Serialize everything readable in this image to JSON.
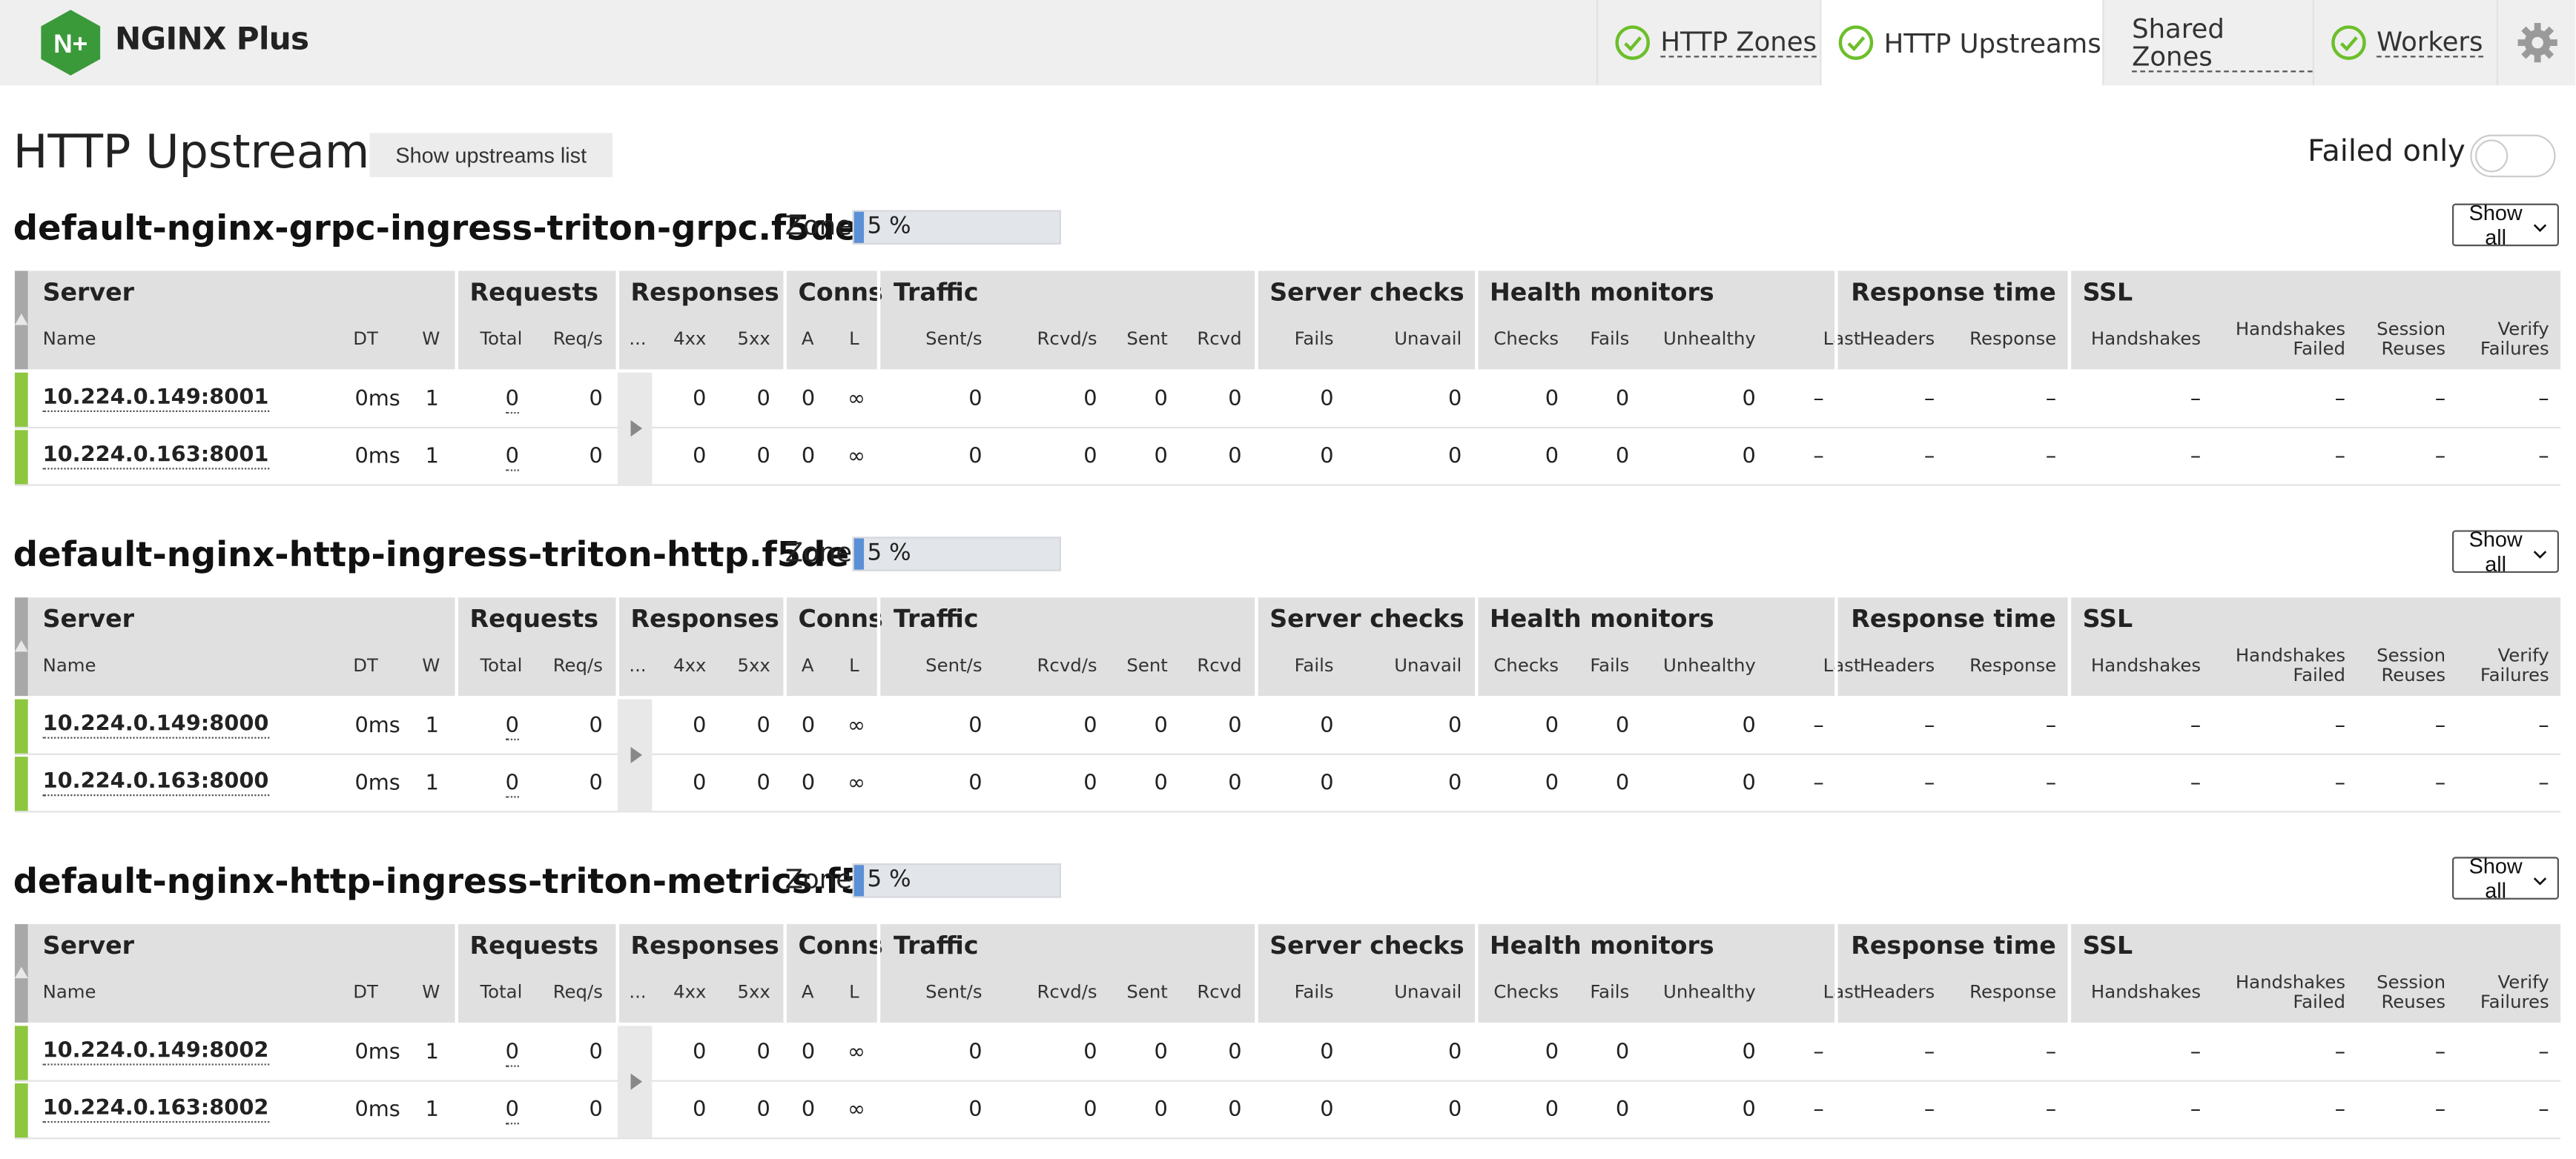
{
  "brand": {
    "name": "NGINX Plus",
    "logo_glyph": "N+",
    "color": "#3a9a3a"
  },
  "nav": {
    "tabs": [
      {
        "label": "HTTP Zones",
        "status": "ok",
        "active": false
      },
      {
        "label": "HTTP Upstreams",
        "status": "ok",
        "active": true
      },
      {
        "label": "Shared Zones",
        "status": "",
        "active": false
      },
      {
        "label": "Workers",
        "status": "ok",
        "active": false
      }
    ],
    "settings_icon": "gear-icon"
  },
  "page": {
    "title": "HTTP Upstreams",
    "list_button": "Show upstreams list",
    "failed_only_label": "Failed only",
    "failed_only_on": false
  },
  "columns": {
    "groups": [
      "Server",
      "Requests",
      "Responses",
      "Conns",
      "Traffic",
      "Server checks",
      "Health monitors",
      "Response time",
      "SSL"
    ],
    "sub": [
      "Name",
      "DT",
      "W",
      "Total",
      "Req/s",
      "...",
      "4xx",
      "5xx",
      "A",
      "L",
      "Sent/s",
      "Rcvd/s",
      "Sent",
      "Rcvd",
      "Fails",
      "Unavail",
      "Checks",
      "Fails",
      "Unhealthy",
      "Last",
      "Headers",
      "Response",
      "Handshakes",
      "Handshakes Failed",
      "Session Reuses",
      "Verify Failures"
    ]
  },
  "upstreams": [
    {
      "name": "default-nginx-grpc-ingress-triton-grpc.f5de...",
      "zone_label": "Zone:",
      "zone_percent": "5 %",
      "zone_fraction": 0.05,
      "show_all": "Show all",
      "servers": [
        {
          "name": "10.224.0.149:8001",
          "dt": "0ms",
          "w": "1",
          "total": "0",
          "req_s": "0",
          "r4xx": "0",
          "r5xx": "0",
          "a": "0",
          "l": "∞",
          "sent_s": "0",
          "rcvd_s": "0",
          "sent": "0",
          "rcvd": "0",
          "fails": "0",
          "unavail": "0",
          "checks": "0",
          "hm_fails": "0",
          "unhealthy": "0",
          "last": "–",
          "headers": "–",
          "response": "–",
          "handshakes": "–",
          "hs_failed": "–",
          "session_reuses": "–",
          "verify_failures": "–"
        },
        {
          "name": "10.224.0.163:8001",
          "dt": "0ms",
          "w": "1",
          "total": "0",
          "req_s": "0",
          "r4xx": "0",
          "r5xx": "0",
          "a": "0",
          "l": "∞",
          "sent_s": "0",
          "rcvd_s": "0",
          "sent": "0",
          "rcvd": "0",
          "fails": "0",
          "unavail": "0",
          "checks": "0",
          "hm_fails": "0",
          "unhealthy": "0",
          "last": "–",
          "headers": "–",
          "response": "–",
          "handshakes": "–",
          "hs_failed": "–",
          "session_reuses": "–",
          "verify_failures": "–"
        }
      ]
    },
    {
      "name": "default-nginx-http-ingress-triton-http.f5de...",
      "zone_label": "Zone:",
      "zone_percent": "5 %",
      "zone_fraction": 0.05,
      "show_all": "Show all",
      "servers": [
        {
          "name": "10.224.0.149:8000",
          "dt": "0ms",
          "w": "1",
          "total": "0",
          "req_s": "0",
          "r4xx": "0",
          "r5xx": "0",
          "a": "0",
          "l": "∞",
          "sent_s": "0",
          "rcvd_s": "0",
          "sent": "0",
          "rcvd": "0",
          "fails": "0",
          "unavail": "0",
          "checks": "0",
          "hm_fails": "0",
          "unhealthy": "0",
          "last": "–",
          "headers": "–",
          "response": "–",
          "handshakes": "–",
          "hs_failed": "–",
          "session_reuses": "–",
          "verify_failures": "–"
        },
        {
          "name": "10.224.0.163:8000",
          "dt": "0ms",
          "w": "1",
          "total": "0",
          "req_s": "0",
          "r4xx": "0",
          "r5xx": "0",
          "a": "0",
          "l": "∞",
          "sent_s": "0",
          "rcvd_s": "0",
          "sent": "0",
          "rcvd": "0",
          "fails": "0",
          "unavail": "0",
          "checks": "0",
          "hm_fails": "0",
          "unhealthy": "0",
          "last": "–",
          "headers": "–",
          "response": "–",
          "handshakes": "–",
          "hs_failed": "–",
          "session_reuses": "–",
          "verify_failures": "–"
        }
      ]
    },
    {
      "name": "default-nginx-http-ingress-triton-metrics.f5...",
      "zone_label": "Zone:",
      "zone_percent": "5 %",
      "zone_fraction": 0.05,
      "show_all": "Show all",
      "servers": [
        {
          "name": "10.224.0.149:8002",
          "dt": "0ms",
          "w": "1",
          "total": "0",
          "req_s": "0",
          "r4xx": "0",
          "r5xx": "0",
          "a": "0",
          "l": "∞",
          "sent_s": "0",
          "rcvd_s": "0",
          "sent": "0",
          "rcvd": "0",
          "fails": "0",
          "unavail": "0",
          "checks": "0",
          "hm_fails": "0",
          "unhealthy": "0",
          "last": "–",
          "headers": "–",
          "response": "–",
          "handshakes": "–",
          "hs_failed": "–",
          "session_reuses": "–",
          "verify_failures": "–"
        },
        {
          "name": "10.224.0.163:8002",
          "dt": "0ms",
          "w": "1",
          "total": "0",
          "req_s": "0",
          "r4xx": "0",
          "r5xx": "0",
          "a": "0",
          "l": "∞",
          "sent_s": "0",
          "rcvd_s": "0",
          "sent": "0",
          "rcvd": "0",
          "fails": "0",
          "unavail": "0",
          "checks": "0",
          "hm_fails": "0",
          "unhealthy": "0",
          "last": "–",
          "headers": "–",
          "response": "–",
          "handshakes": "–",
          "hs_failed": "–",
          "session_reuses": "–",
          "verify_failures": "–"
        }
      ]
    }
  ],
  "colors": {
    "accent_green": "#8dc63f",
    "zone_fill": "#5b8fd6",
    "header_bg": "#e0e0e0",
    "ok_icon": "#6cbf2a"
  }
}
